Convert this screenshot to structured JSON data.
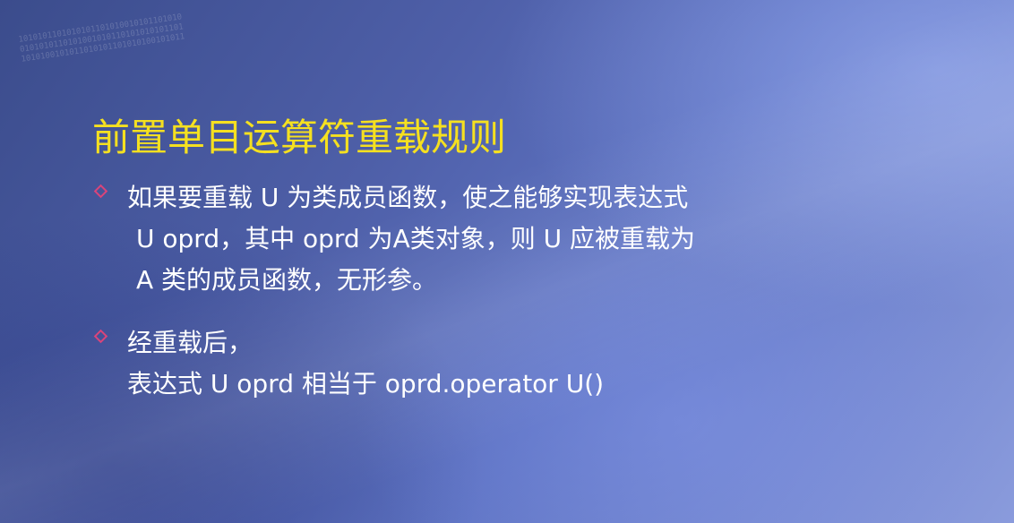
{
  "slide": {
    "title": "前置单目运算符重载规则",
    "bullets": [
      {
        "lines": [
          "如果要重载 U 为类成员函数，使之能够实现表达式",
          "U oprd，其中 oprd 为A类对象，则 U 应被重载为",
          "A 类的成员函数，无形参。"
        ]
      },
      {
        "lines": [
          "经重载后，",
          "表达式 U oprd 相当于 oprd.operator U()"
        ]
      }
    ],
    "bullet_icon": "diamond-icon",
    "colors": {
      "title": "#f5e020",
      "body_text": "#ffffff",
      "bullet": "#d9447a",
      "background_dark": "#3b4c8c",
      "background_light": "#8a9bdc"
    }
  }
}
